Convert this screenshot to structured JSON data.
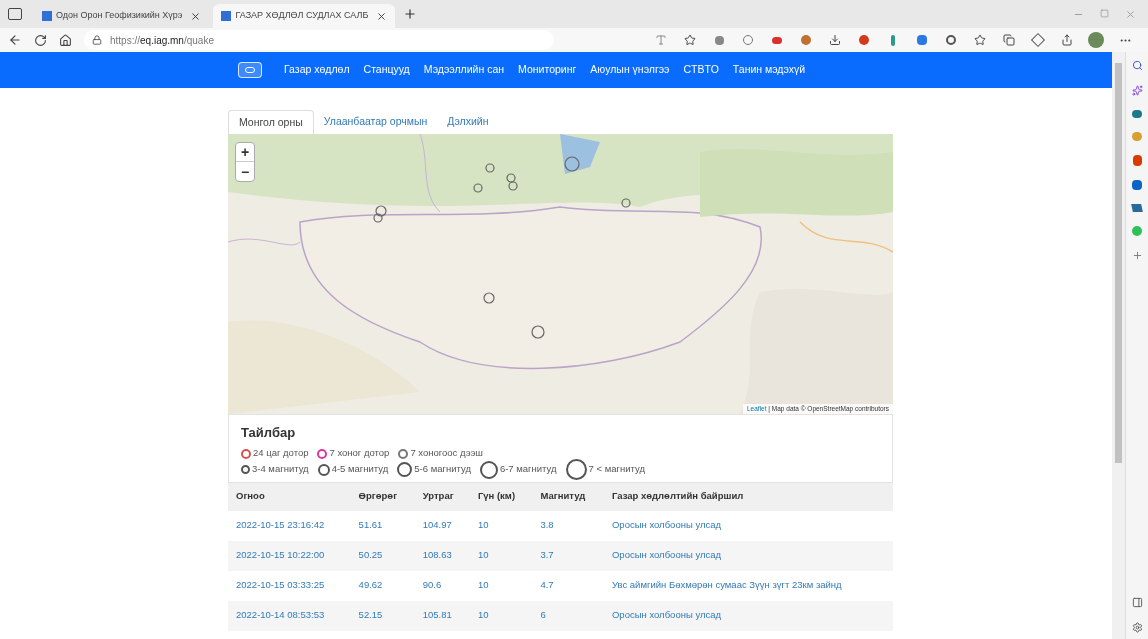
{
  "browser": {
    "tabs": [
      {
        "title": "Одон Орон Геофизикийн Хүрэ",
        "selected": false
      },
      {
        "title": "ГАЗАР ХӨДЛӨЛ СУДЛАХ САЛБ",
        "selected": true
      }
    ],
    "address": {
      "prefix": "https://",
      "host": "eq.iag.mn",
      "path": "/quake"
    }
  },
  "nav": {
    "items": [
      {
        "label": "Газар хөдлөл"
      },
      {
        "label": "Станцууд"
      },
      {
        "label": "Мэдээллийн сан"
      },
      {
        "label": "Мониторинг"
      },
      {
        "label": "Аюулын үнэлгээ"
      },
      {
        "label": "CTBTO"
      },
      {
        "label": "Танин мэдэхүй"
      }
    ]
  },
  "region_tabs": [
    {
      "label": "Монгол орны",
      "selected": true
    },
    {
      "label": "Улаанбаатар орчмын",
      "selected": false
    },
    {
      "label": "Дэлхийн",
      "selected": false
    }
  ],
  "map": {
    "zoom_in": "+",
    "zoom_out": "−",
    "attribution_link": "Leaflet",
    "attribution_text": " | Map data © OpenStreetMap contributors"
  },
  "legend": {
    "title": "Тайлбар",
    "rows": [
      [
        {
          "label": "24 цаг дотор",
          "color": "#d9534f"
        },
        {
          "label": "7 хоног дотор",
          "color": "#d63aa8"
        },
        {
          "label": "7 хоногоос дээш",
          "color": "#777777"
        }
      ],
      [
        {
          "label": "3-4 магнитуд",
          "color": "#555555"
        },
        {
          "label": "4-5 магнитуд",
          "color": "#555555"
        },
        {
          "label": "5-6 магнитуд",
          "color": "#555555"
        },
        {
          "label": "6-7 магнитуд",
          "color": "#555555"
        },
        {
          "label": "7 < магнитуд",
          "color": "#555555"
        }
      ]
    ]
  },
  "table": {
    "columns": [
      "Огноо",
      "Өргөрөг",
      "Уртраг",
      "Гүн (км)",
      "Магнитуд",
      "Газар хөдлөлтийн байршил"
    ],
    "rows": [
      [
        "2022-10-15 23:16:42",
        "51.61",
        "104.97",
        "10",
        "3.8",
        "Оросын холбооны улсад"
      ],
      [
        "2022-10-15 10:22:00",
        "50.25",
        "108.63",
        "10",
        "3.7",
        "Оросын холбооны улсад"
      ],
      [
        "2022-10-15 03:33:25",
        "49.62",
        "90.6",
        "10",
        "4.7",
        "Увс аймгийн Бөхмөрөн сумаас Зүүн зүгт 23км зайнд"
      ],
      [
        "2022-10-14 08:53:53",
        "52.15",
        "105.81",
        "10",
        "6",
        "Оросын холбооны улсад"
      ]
    ]
  }
}
